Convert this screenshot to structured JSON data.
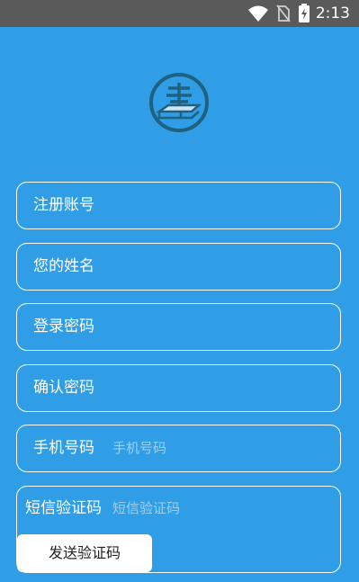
{
  "status_bar": {
    "time": "2:13",
    "icons": [
      "wifi-icon",
      "no-sim-icon",
      "battery-charging-icon"
    ]
  },
  "logo": {
    "icon": "book-logo-icon"
  },
  "form": {
    "account": {
      "label": "注册账号",
      "placeholder": ""
    },
    "name": {
      "label": "您的姓名",
      "placeholder": ""
    },
    "password": {
      "label": "登录密码",
      "placeholder": ""
    },
    "confirm_password": {
      "label": "确认密码",
      "placeholder": ""
    },
    "phone": {
      "label": "手机号码",
      "placeholder": "手机号码"
    },
    "sms_code": {
      "label": "短信验证码",
      "placeholder": "短信验证码"
    },
    "send_code_button": "发送验证码"
  },
  "colors": {
    "background": "#2f9ee6",
    "status_bar": "#5a5a5a",
    "field_border": "#ffffff",
    "placeholder": "#9fd0f2",
    "logo_ring": "#1f6180"
  }
}
